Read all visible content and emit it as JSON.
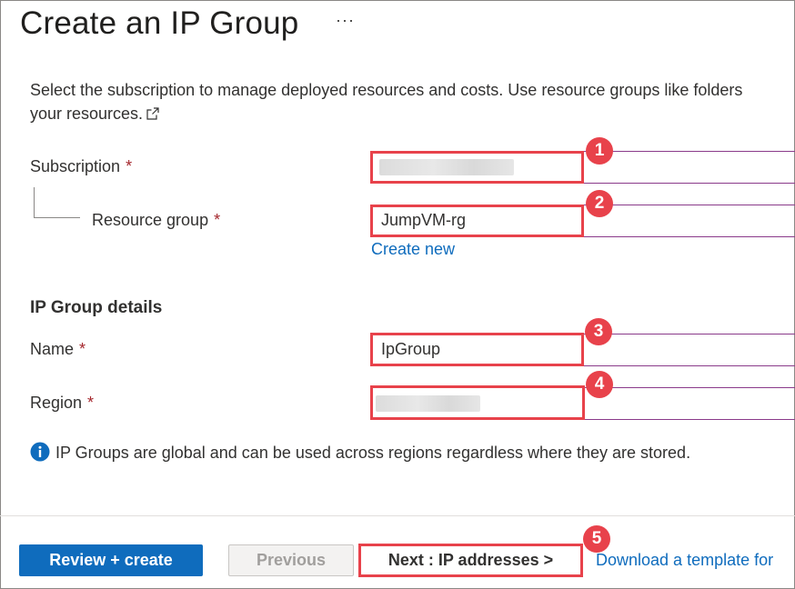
{
  "header": {
    "title": "Create an IP Group",
    "more_label": "···"
  },
  "description": {
    "line1": "Select the subscription to manage deployed resources and costs. Use resource groups like folders",
    "line2": "your resources."
  },
  "form": {
    "subscription": {
      "label": "Subscription",
      "required": "*",
      "value": ""
    },
    "resource_group": {
      "label": "Resource group",
      "required": "*",
      "value": "JumpVM-rg",
      "create_new": "Create new"
    },
    "details_heading": "IP Group details",
    "name": {
      "label": "Name",
      "required": "*",
      "value": "IpGroup"
    },
    "region": {
      "label": "Region",
      "required": "*",
      "value": ""
    },
    "info_text": "IP Groups are global and can be used across regions regardless where they are stored."
  },
  "badges": [
    "1",
    "2",
    "3",
    "4",
    "5"
  ],
  "footer": {
    "review_create": "Review + create",
    "previous": "Previous",
    "next": "Next : IP addresses >",
    "download_template": "Download a template for"
  },
  "colors": {
    "accent": "#0f6cbd",
    "annotation_red": "#e8424b",
    "required": "#a4262c"
  },
  "icons": {
    "external_link": "external-link-icon",
    "info": "info-icon",
    "more": "more-icon"
  }
}
